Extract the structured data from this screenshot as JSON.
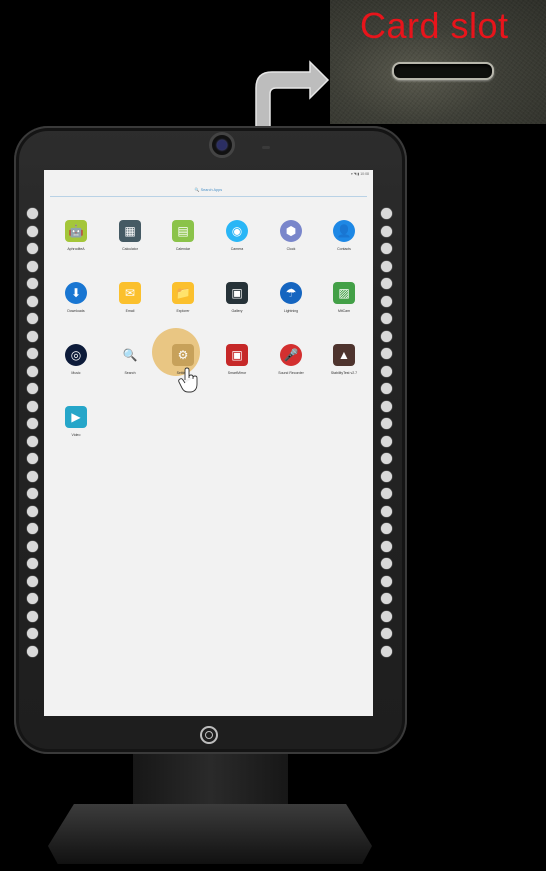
{
  "inset": {
    "title": "Card slot",
    "title_color": "#e8141b"
  },
  "screen": {
    "status": "▾ ◥ ▮ 10:08",
    "search_label": "🔍 Search Apps",
    "apps": [
      {
        "label": "AphroditeA",
        "icon": "android-icon",
        "bg": "#a4c639",
        "glyph": "🤖"
      },
      {
        "label": "Calculator",
        "icon": "calculator-icon",
        "bg": "#455a64",
        "glyph": "▦"
      },
      {
        "label": "Calendar",
        "icon": "calendar-icon",
        "bg": "#8bc34a",
        "glyph": "▤"
      },
      {
        "label": "Camera",
        "icon": "camera-icon",
        "bg": "#29b6f6",
        "glyph": "◉"
      },
      {
        "label": "Clock",
        "icon": "clock-icon",
        "bg": "#7986cb",
        "glyph": "⬢"
      },
      {
        "label": "Contacts",
        "icon": "contacts-icon",
        "bg": "#1e88e5",
        "glyph": "👤"
      },
      {
        "label": "Downloads",
        "icon": "downloads-icon",
        "bg": "#1976d2",
        "glyph": "⬇"
      },
      {
        "label": "Email",
        "icon": "email-icon",
        "bg": "#fbc02d",
        "glyph": "✉"
      },
      {
        "label": "Explorer",
        "icon": "explorer-icon",
        "bg": "#fbc02d",
        "glyph": "📁"
      },
      {
        "label": "Gallery",
        "icon": "gallery-icon",
        "bg": "#263238",
        "glyph": "▣"
      },
      {
        "label": "Lightning",
        "icon": "lightning-icon",
        "bg": "#1565c0",
        "glyph": "☂"
      },
      {
        "label": "MtiCam",
        "icon": "mticam-icon",
        "bg": "#43a047",
        "glyph": "▨"
      },
      {
        "label": "Music",
        "icon": "music-icon",
        "bg": "#0d1b3a",
        "glyph": "◎"
      },
      {
        "label": "Search",
        "icon": "search-icon",
        "bg": "transparent",
        "glyph": "🔍"
      },
      {
        "label": "Settings",
        "icon": "settings-icon",
        "bg": "#c7a15a",
        "glyph": "⚙"
      },
      {
        "label": "SmartMirror",
        "icon": "smartmirror-icon",
        "bg": "#c62828",
        "glyph": "▣"
      },
      {
        "label": "Sound Recorder",
        "icon": "sound-recorder-icon",
        "bg": "#d32f2f",
        "glyph": "🎤"
      },
      {
        "label": "StabilityTest v2.7",
        "icon": "stabilitytest-icon",
        "bg": "#4e342e",
        "glyph": "▲"
      },
      {
        "label": "Video",
        "icon": "video-icon",
        "bg": "#26a6c9",
        "glyph": "▶"
      }
    ]
  }
}
